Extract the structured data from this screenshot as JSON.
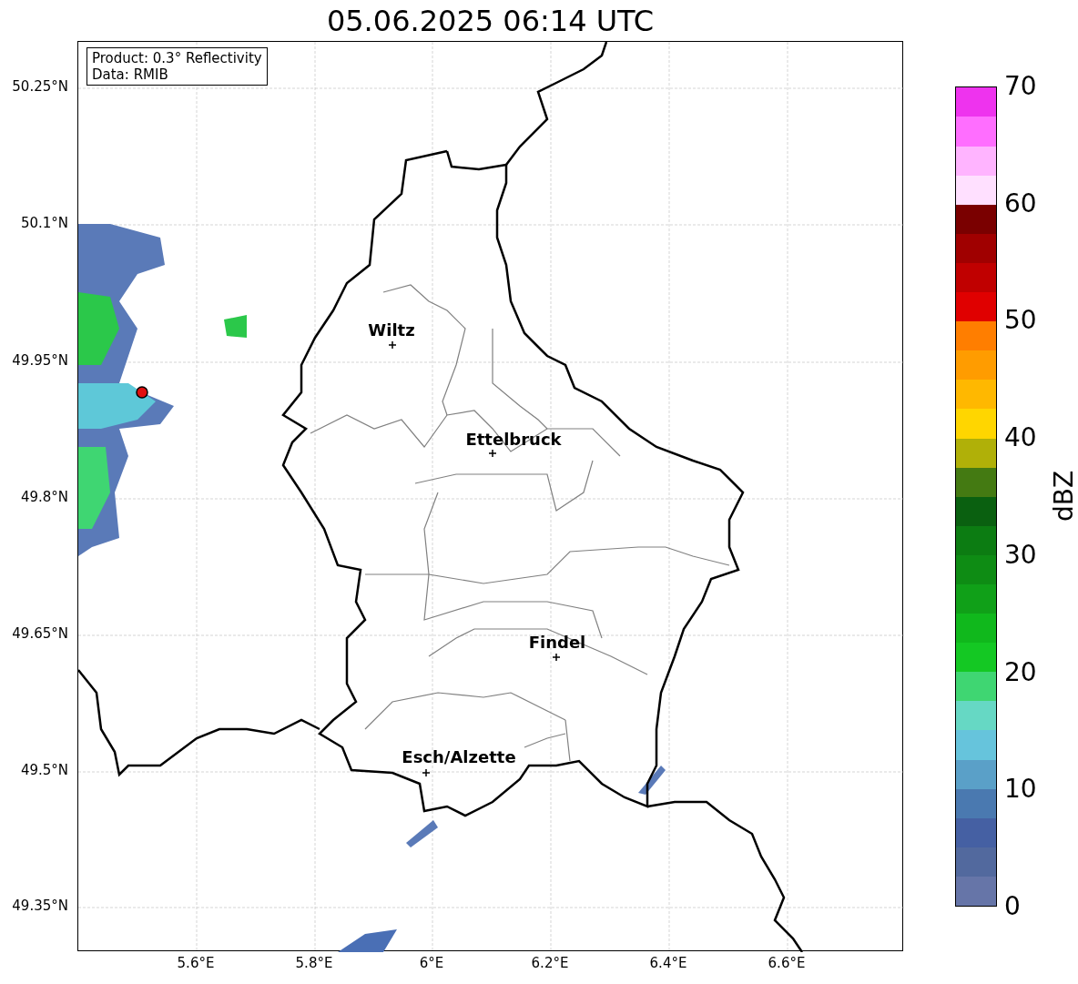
{
  "title": "05.06.2025 06:14 UTC",
  "legend": {
    "product": "Product: 0.3° Reflectivity",
    "data": "Data: RMIB"
  },
  "y_ticks": [
    "50.25°N",
    "50.1°N",
    "49.95°N",
    "49.8°N",
    "49.65°N",
    "49.5°N",
    "49.35°N"
  ],
  "x_ticks": [
    "5.6°E",
    "5.8°E",
    "6°E",
    "6.2°E",
    "6.4°E",
    "6.6°E"
  ],
  "cities": [
    {
      "name": "Wiltz"
    },
    {
      "name": "Ettelbruck"
    },
    {
      "name": "Findel"
    },
    {
      "name": "Esch/Alzette"
    }
  ],
  "colorbar": {
    "label": "dBZ",
    "ticks": [
      "70",
      "60",
      "50",
      "40",
      "30",
      "20",
      "10",
      "0"
    ],
    "bins": [
      {
        "color": "#6675a8"
      },
      {
        "color": "#52699e"
      },
      {
        "color": "#4560a3"
      },
      {
        "color": "#4a79b0"
      },
      {
        "color": "#5aa0c8"
      },
      {
        "color": "#66c4dc"
      },
      {
        "color": "#66d8c4"
      },
      {
        "color": "#3fd672"
      },
      {
        "color": "#14c823"
      },
      {
        "color": "#10b81c"
      },
      {
        "color": "#10a018"
      },
      {
        "color": "#0e8c14"
      },
      {
        "color": "#0c7c12"
      },
      {
        "color": "#0a6010"
      },
      {
        "color": "#447a12"
      },
      {
        "color": "#b0b008"
      },
      {
        "color": "#ffd600"
      },
      {
        "color": "#ffb800"
      },
      {
        "color": "#ff9c00"
      },
      {
        "color": "#ff7e00"
      },
      {
        "color": "#e00000"
      },
      {
        "color": "#c00000"
      },
      {
        "color": "#a00000"
      },
      {
        "color": "#7a0000"
      },
      {
        "color": "#ffe0ff"
      },
      {
        "color": "#ffb4ff"
      },
      {
        "color": "#ff6eff"
      },
      {
        "color": "#ee33ee"
      }
    ]
  }
}
